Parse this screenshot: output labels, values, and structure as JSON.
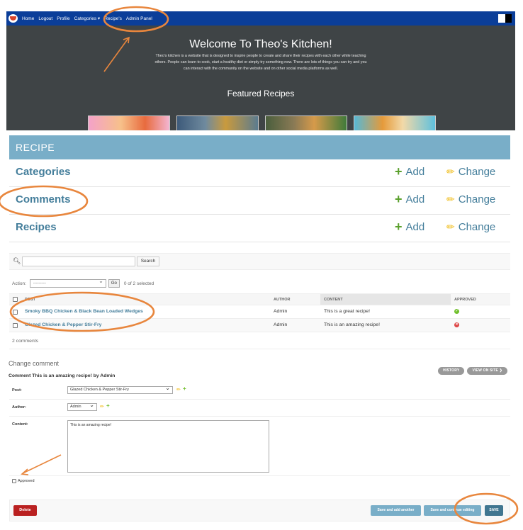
{
  "site": {
    "nav": [
      "Home",
      "Logout",
      "Profile",
      "Categories ▾",
      "Recipe's",
      "Admin Panel"
    ],
    "hero_title": "Welcome To Theo's Kitchen!",
    "hero_text": "Theo's kitchen is a website that is designed to inspire people to create and share their recipes with each other while teaching others. People can learn to cook, start a healthy diet or simply try something new. There are lots of things you can try and you can interact with the community on the website and on other social media platforms as well.",
    "featured_heading": "Featured Recipes"
  },
  "admin_module": {
    "caption": "RECIPE",
    "add_label": "Add",
    "change_label": "Change",
    "models": [
      "Categories",
      "Comments",
      "Recipes"
    ]
  },
  "changelist": {
    "search_button": "Search",
    "action_label": "Action:",
    "action_value": "---------",
    "go_button": "Go",
    "selected_text": "0 of 2 selected",
    "headers": {
      "post": "POST",
      "author": "AUTHOR",
      "content": "CONTENT",
      "approved": "APPROVED"
    },
    "rows": [
      {
        "post": "Smoky BBQ Chicken & Black Bean Loaded Wedges",
        "author": "Admin",
        "content": "This is a great recipe!",
        "approved": true
      },
      {
        "post": "Glazed Chicken & Pepper Stir-Fry",
        "author": "Admin",
        "content": "This is an amazing recipe!",
        "approved": false
      }
    ],
    "count_text": "2 comments"
  },
  "change_form": {
    "title": "Change comment",
    "subtitle": "Comment This is an amazing recipe! by Admin",
    "history_button": "HISTORY",
    "view_on_site_button": "VIEW ON SITE ❯",
    "post_label": "Post:",
    "post_value": "Glazed Chicken & Pepper Stir-Fry",
    "author_label": "Author:",
    "author_value": "Admin",
    "content_label": "Content:",
    "content_value": "This is an amazing recipe!",
    "approved_label": "Approved",
    "delete_button": "Delete",
    "save_add_another": "Save and add another",
    "save_continue": "Save and continue editing",
    "save_button": "SAVE"
  },
  "colors": {
    "navbar": "#0b3e99",
    "hero_bg": "#3f4446",
    "module_header": "#79aec8",
    "link": "#447e9b",
    "annotation": "#e8863d",
    "delete": "#ba2121",
    "save": "#417690"
  }
}
